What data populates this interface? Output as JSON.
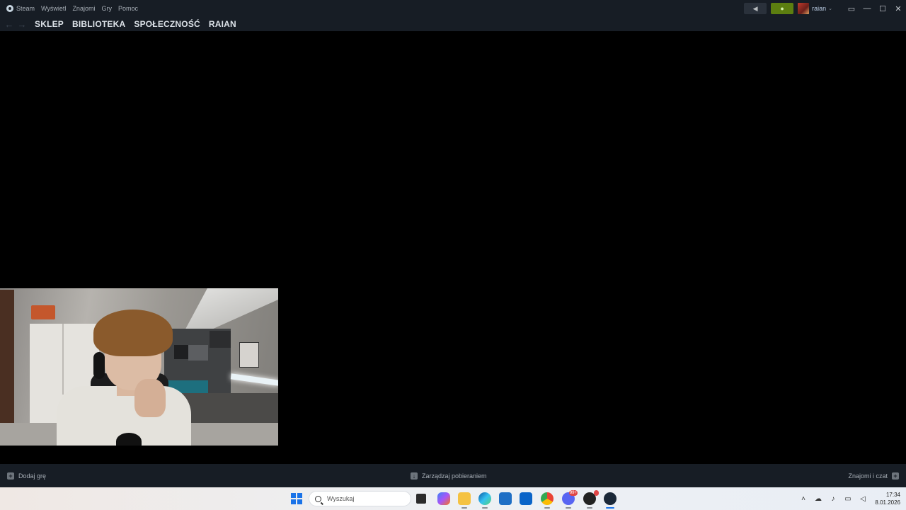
{
  "menu": {
    "items": [
      "Steam",
      "Wyświetl",
      "Znajomi",
      "Gry",
      "Pomoc"
    ]
  },
  "titlebar": {
    "username": "raian",
    "announce_icon": "megaphone-icon",
    "notification_icon": "bell-icon",
    "notification_color": "#5c7e10"
  },
  "nav": {
    "links": [
      "SKLEP",
      "BIBLIOTEKA",
      "SPOŁECZNOŚĆ",
      "RAIAN"
    ]
  },
  "bottombar": {
    "add_game": "Dodaj grę",
    "downloads": "Zarządzaj pobieraniem",
    "friends_chat": "Znajomi i czat"
  },
  "taskbar": {
    "search_placeholder": "Wyszukaj",
    "time": "17:34",
    "date": "8.01.2026",
    "discord_badge": "99+"
  },
  "colors": {
    "steam_bar": "#171d25",
    "accent": "#1a73e8"
  }
}
